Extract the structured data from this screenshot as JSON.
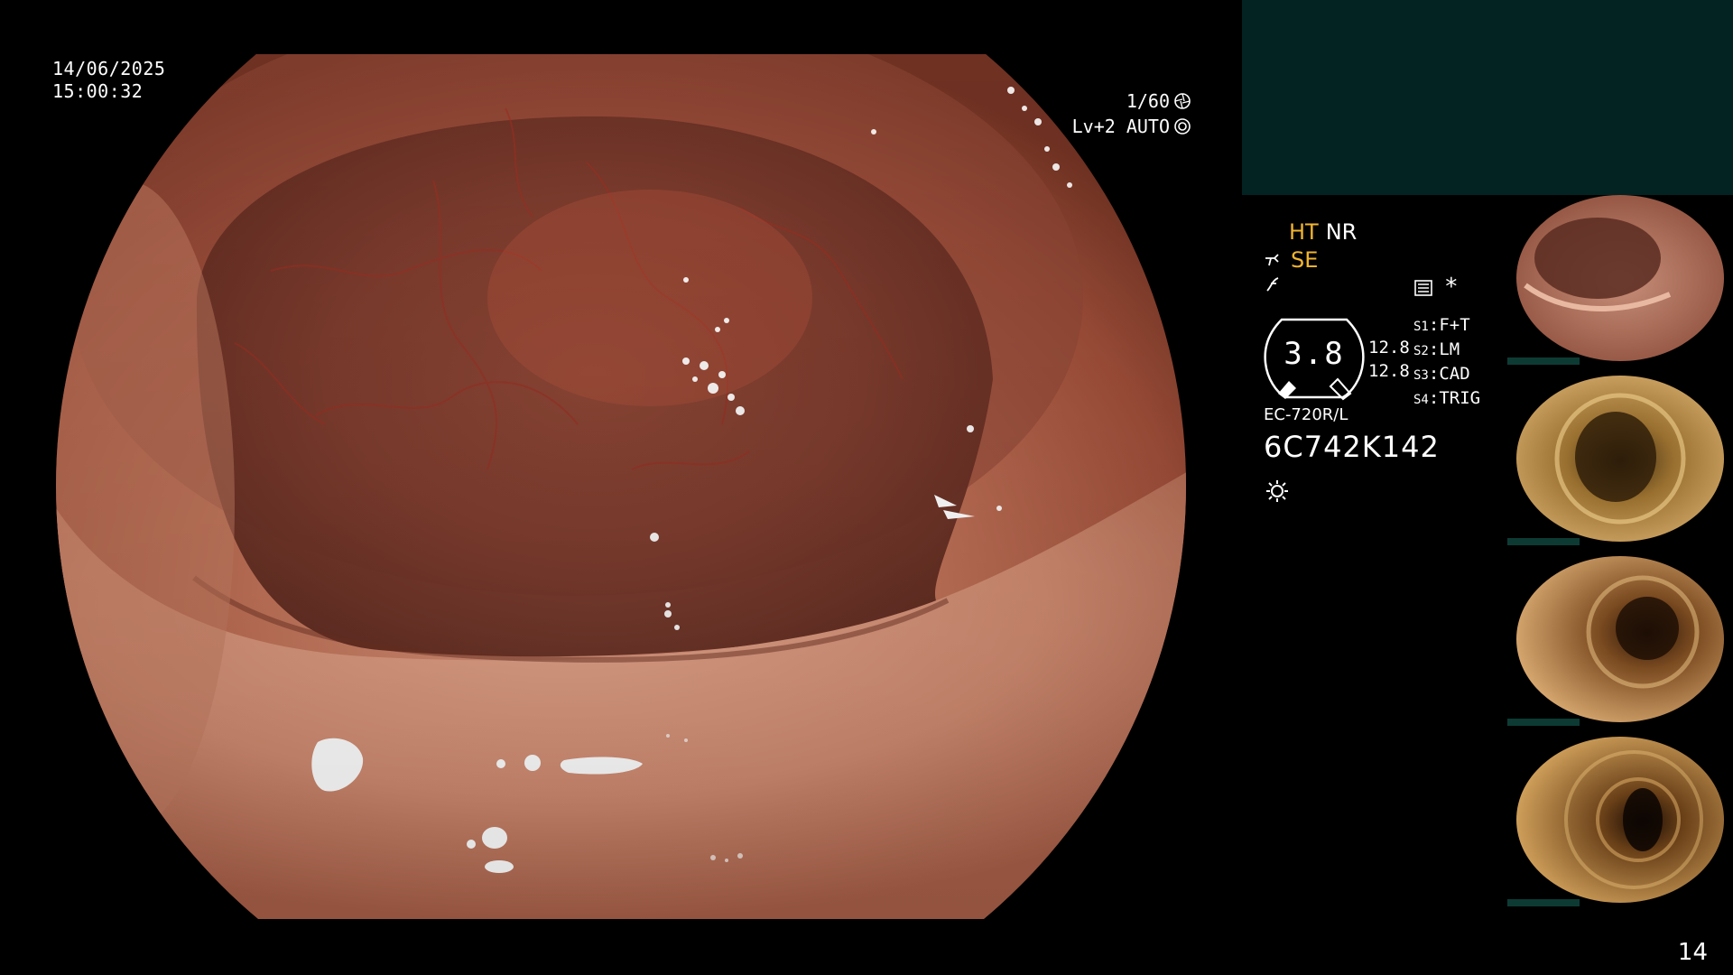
{
  "overlay": {
    "date": "14/06/2025",
    "time": "15:00:32",
    "shutter": "1/60",
    "level": "Lv+2 AUTO"
  },
  "panel": {
    "mode_ht": "HT",
    "mode_nr": "NR",
    "mode_se": "SE",
    "gauge_value": "3.8",
    "reading_1": "12.8",
    "reading_2": "12.8",
    "settings": [
      {
        "key": "S1",
        "value": "F+T"
      },
      {
        "key": "S2",
        "value": "LM"
      },
      {
        "key": "S3",
        "value": "CAD"
      },
      {
        "key": "S4",
        "value": "TRIG"
      }
    ],
    "model": "EC-720R/L",
    "serial": "6C742K142",
    "page_number": "14"
  },
  "colors": {
    "accent_yellow": "#f2b431",
    "panel_teal": "#032322",
    "thumb_bar": "#0d3b34"
  },
  "icons": [
    "shutter-icon",
    "auto-iris-icon",
    "scope-icon",
    "structure-icon",
    "keyboard-icon",
    "sun-icon"
  ]
}
